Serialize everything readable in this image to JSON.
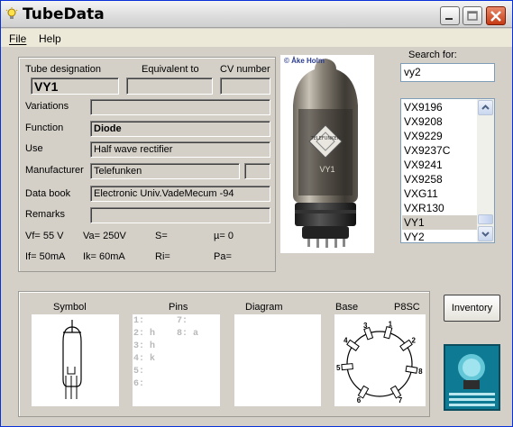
{
  "window": {
    "title": "TubeData"
  },
  "menu": {
    "file": "File",
    "help": "Help"
  },
  "labels": {
    "tube_designation": "Tube designation",
    "equivalent_to": "Equivalent to",
    "cv_number": "CV number",
    "variations": "Variations",
    "function": "Function",
    "use": "Use",
    "manufacturer": "Manufacturer",
    "data_book": "Data book",
    "remarks": "Remarks"
  },
  "tube": {
    "designation": "VY1",
    "equivalent_to": "",
    "cv_number": "",
    "variations": "",
    "function": "Diode",
    "use": "Half wave rectifier",
    "manufacturer": "Telefunken",
    "manufacturer_extra": "",
    "data_book": "Electronic Univ.VadeMecum -94",
    "remarks": ""
  },
  "params": {
    "vf": "Vf= 55 V",
    "va": "Va=  250V",
    "s": "S=",
    "mu": "µ=    0",
    "if": "If= 50mA",
    "ik": "Ik=   60mA",
    "ri": "Ri=",
    "pa": "Pa="
  },
  "photo_credit": "© Åke Holm",
  "tube_photo_text": "TELEFUNKEN",
  "search": {
    "label": "Search for:",
    "value": "vy2"
  },
  "list": {
    "items": [
      "VX9196",
      "VX9208",
      "VX9229",
      "VX9237C",
      "VX9241",
      "VX9258",
      "VXG11",
      "VXR130",
      "VY1",
      "VY2"
    ],
    "selected_index": 8
  },
  "bottom": {
    "symbol": "Symbol",
    "pins": "Pins",
    "diagram": "Diagram",
    "base": "Base",
    "base_type": "P8SC",
    "pins_left": [
      "1:",
      "2: h",
      "3: h",
      "4: k",
      "5:",
      "6:"
    ],
    "pins_right": [
      "7:",
      "8: a"
    ],
    "base_pin_numbers": [
      "1",
      "2",
      "3",
      "4",
      "5",
      "6",
      "7",
      "8"
    ]
  },
  "inventory_button": "Inventory",
  "colors": {
    "titlebar_border": "#0831d9",
    "dialog_bg": "#d4d0c8",
    "close_button": "#c43a14"
  }
}
